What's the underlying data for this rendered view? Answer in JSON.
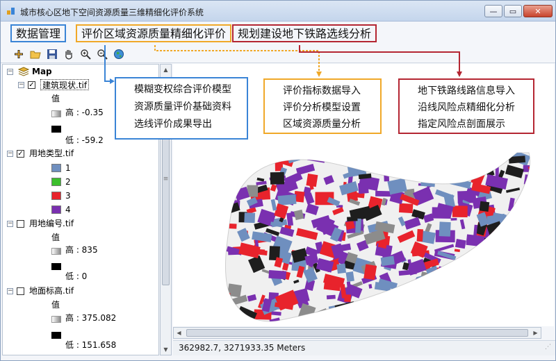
{
  "window": {
    "title": "城市核心区地下空间资源质量三维精细化评价系统",
    "controls": {
      "minimize": "—",
      "maximize": "▭",
      "close": "✕"
    }
  },
  "menus": [
    {
      "label": "数据管理",
      "color": "#3a84d6",
      "items": [
        "模糊变权综合评价模型",
        "资源质量评价基础资料",
        "选线评价成果导出"
      ]
    },
    {
      "label": "评价区域资源质量精细化评价",
      "color": "#f0a828",
      "items": [
        "评价指标数据导入",
        "评价分析模型设置",
        "区域资源质量分析"
      ]
    },
    {
      "label": "规划建设地下铁路选线分析",
      "color": "#b42632",
      "items": [
        "地下铁路线路信息导入",
        "沿线风险点精细化分析",
        "指定风险点剖面展示"
      ]
    }
  ],
  "toolbar": {
    "buttons": [
      "add-data-icon",
      "open-folder-icon",
      "save-icon",
      "pan-hand-icon",
      "zoom-in-icon",
      "zoom-out-icon",
      "globe-icon"
    ]
  },
  "toc": {
    "root": "Map",
    "layers": [
      {
        "name": "建筑现状.tif",
        "checked": true,
        "value_label": "值",
        "high": "高 : -0.35",
        "low": "低 : -59.2"
      },
      {
        "name": "用地类型.tif",
        "checked": true,
        "classes": [
          {
            "label": "1",
            "color": "#6f8fbf"
          },
          {
            "label": "2",
            "color": "#3cbf2c"
          },
          {
            "label": "3",
            "color": "#e8232c"
          },
          {
            "label": "4",
            "color": "#7a30b0"
          }
        ]
      },
      {
        "name": "用地编号.tif",
        "checked": false,
        "value_label": "值",
        "high": "高 : 835",
        "low": "低 : 0"
      },
      {
        "name": "地面标高.tif",
        "checked": false,
        "value_label": "值",
        "high": "高 : 375.082",
        "low": "低 : 151.658"
      }
    ]
  },
  "status": {
    "coords": "362982.7, 3271933.35  Meters"
  },
  "colors": {
    "landuse_1": "#6f8fbf",
    "landuse_3": "#e8232c",
    "landuse_4": "#7a30b0",
    "dark": "#1e1e1e",
    "grey": "#8c8c8c"
  }
}
